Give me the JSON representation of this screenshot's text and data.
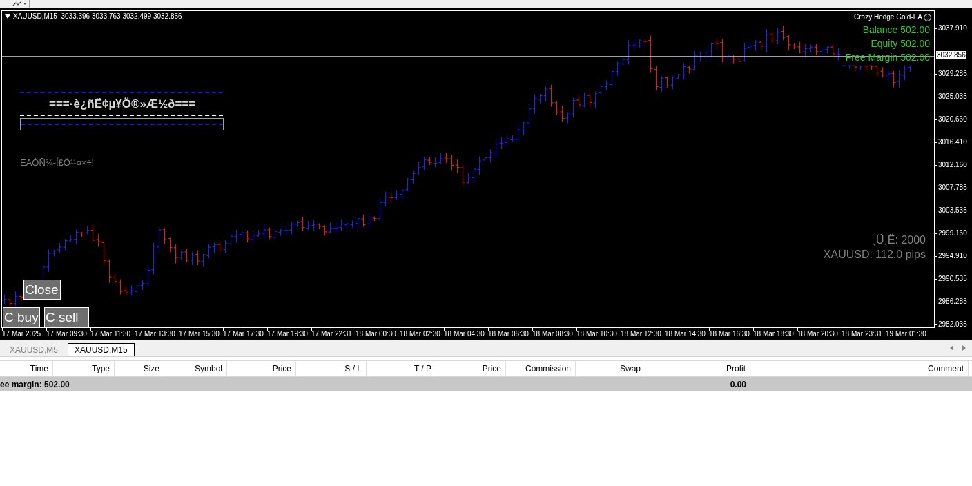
{
  "chart": {
    "symbol_info": "XAUUSD,M15  3033.396 3033.763 3032.499 3032.856",
    "ea_name": "Crazy Hedge Gold-EA",
    "account": [
      "Balance 502.00",
      "Equity 502.00",
      "Free Margin 502.00"
    ],
    "panel_title": "===·è¿ñË¢µ¥Ö®»Æ½ð===",
    "status_text": "EAÒÑ¾-Í£Ö¹¹¤×÷!",
    "info_lines": [
      "¸Ü¸Ë: 2000",
      "XAUUSD: 112.0 pips"
    ],
    "buttons": [
      {
        "kind": "close",
        "label": "Close"
      },
      {
        "kind": "buy",
        "label": "C buy"
      },
      {
        "kind": "sell",
        "label": "C sell"
      }
    ],
    "price_axis": [
      "3037.910",
      "3029.285",
      "3025.035",
      "3020.660",
      "3016.410",
      "3012.160",
      "3007.785",
      "3003.535",
      "2999.160",
      "2994.910",
      "2990.535",
      "2986.285",
      "2982.035"
    ],
    "current_price": "3032.856",
    "time_axis": [
      "17 Mar 2025",
      "17 Mar 09:30",
      "17 Mar 11:30",
      "17 Mar 13:30",
      "17 Mar 15:30",
      "17 Mar 17:30",
      "17 Mar 19:30",
      "17 Mar 22:31",
      "18 Mar 00:30",
      "18 Mar 02:30",
      "18 Mar 04:30",
      "18 Mar 06:30",
      "18 Mar 08:30",
      "18 Mar 10:30",
      "18 Mar 12:30",
      "18 Mar 14:30",
      "18 Mar 16:30",
      "18 Mar 18:30",
      "18 Mar 20:30",
      "18 Mar 23:31",
      "19 Mar 01:30"
    ]
  },
  "tabs": [
    {
      "label": "XAUUSD,M5",
      "selected": false
    },
    {
      "label": "XAUUSD,M15",
      "selected": true
    }
  ],
  "table": {
    "columns": [
      "Time",
      "Type",
      "Size",
      "Symbol",
      "Price",
      "S / L",
      "T / P",
      "Price",
      "Commission",
      "Swap",
      "Profit",
      "Comment"
    ],
    "summary": {
      "label": "ee margin: 502.00",
      "profit": "0.00"
    }
  }
}
